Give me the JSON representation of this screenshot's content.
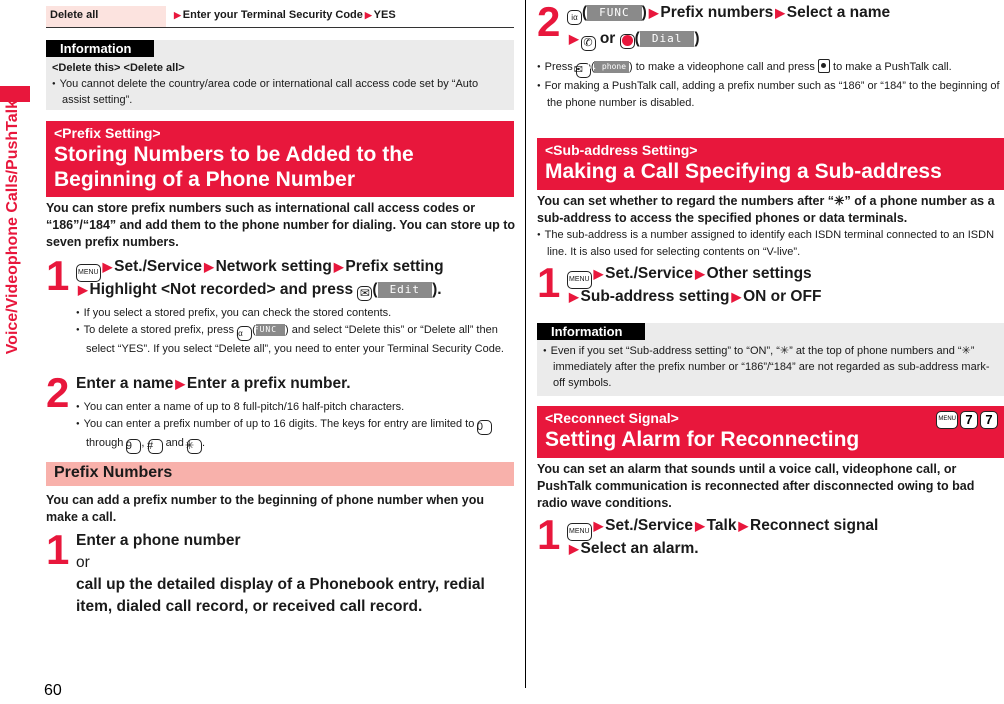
{
  "side": {
    "label": "Voice/Videophone Calls/PushTalk"
  },
  "page_number": "60",
  "left": {
    "delete_row": {
      "label": "Delete all",
      "steps": [
        "Enter your Terminal Security Code",
        "YES"
      ]
    },
    "info1": {
      "tag": "Information",
      "heading": "<Delete this> <Delete all>",
      "bullets": [
        "You cannot delete the country/area code or international call access code set by “Auto assist setting”."
      ]
    },
    "section1": {
      "sub": "<Prefix Setting>",
      "title_line1": "Storing Numbers to be Added to the",
      "title_line2": "Beginning of a Phone Number",
      "lead": "You can store prefix numbers such as international call access codes or “186”/“184” and add them to the phone number for dialing. You can store up to seven prefix numbers.",
      "step1": {
        "num": "1",
        "line1": [
          "Set./Service",
          "Network setting",
          "Prefix setting"
        ],
        "line2_a": "Highlight <Not recorded> and press",
        "softkey": "Edit",
        "bullets": [
          "If you select a stored prefix, you can check the stored contents.",
          "To delete a stored prefix, press",
          "and select “Delete this” or “Delete all” then select “YES”. If you select “Delete all”, you need to enter your Terminal Security Code."
        ],
        "func_softkey": "FUNC"
      },
      "step2": {
        "num": "2",
        "line": [
          "Enter a name",
          "Enter a prefix number."
        ],
        "bullets": [
          "You can enter a name of up to 8 full-pitch/16 half-pitch characters.",
          "You can enter a prefix number of up to 16 digits. The keys for entry are limited to"
        ],
        "keys": {
          "k0": "0",
          "through": "through",
          "k9": "9",
          "hash": "#",
          "and": "and",
          "star": "✳"
        }
      }
    },
    "section2": {
      "title": "Prefix Numbers",
      "lead": "You can add a prefix number to the beginning of phone number when you make a call.",
      "step1": {
        "num": "1",
        "line1": "Enter a phone number",
        "or": "or",
        "line2": "call up the detailed display of a Phonebook entry, redial item, dialed call record, or received call record."
      }
    }
  },
  "right": {
    "step2": {
      "num": "2",
      "func_softkey": "FUNC",
      "line1": [
        "Prefix numbers",
        "Select a name"
      ],
      "or": "or",
      "dial_softkey": "Dial",
      "bullets": [
        {
          "a": "Press",
          "softkey": "V. phone",
          "b": "to make a videophone call and press",
          "c": "to make a PushTalk call."
        },
        "For making a PushTalk call, adding a prefix number such as “186” or “184” to the beginning of the phone number is disabled."
      ]
    },
    "section3": {
      "sub": "<Sub-address Setting>",
      "title": "Making a Call Specifying a Sub-address",
      "lead": "You can set whether to regard the numbers after “✳” of a phone number as a sub-address to access the specified phones or data terminals.",
      "bullets": [
        "The sub-address is a number assigned to identify each ISDN terminal connected to an ISDN line. It is also used for selecting contents on “V-live”."
      ],
      "step1": {
        "num": "1",
        "line1": [
          "Set./Service",
          "Other settings"
        ],
        "line2": [
          "Sub-address setting",
          "ON or OFF"
        ]
      }
    },
    "info2": {
      "tag": "Information",
      "bullets": [
        "Even if you set “Sub-address setting” to “ON”, “✳” at the top of phone numbers and “✳” immediately after the prefix number or “186”/“184” are not regarded as sub-address mark-off symbols."
      ]
    },
    "section4": {
      "sub": "<Reconnect Signal>",
      "title": "Setting Alarm for Reconnecting",
      "shortcut": [
        "MENU",
        "7",
        "7"
      ],
      "lead": "You can set an alarm that sounds until a voice call, videophone call, or PushTalk communication is reconnected after disconnected owing to bad radio wave conditions.",
      "step1": {
        "num": "1",
        "line1": [
          "Set./Service",
          "Talk",
          "Reconnect signal"
        ],
        "line2": "Select an alarm."
      }
    }
  },
  "keys": {
    "menu": "MENU",
    "ialpha": "iα",
    "mail": "✉"
  }
}
